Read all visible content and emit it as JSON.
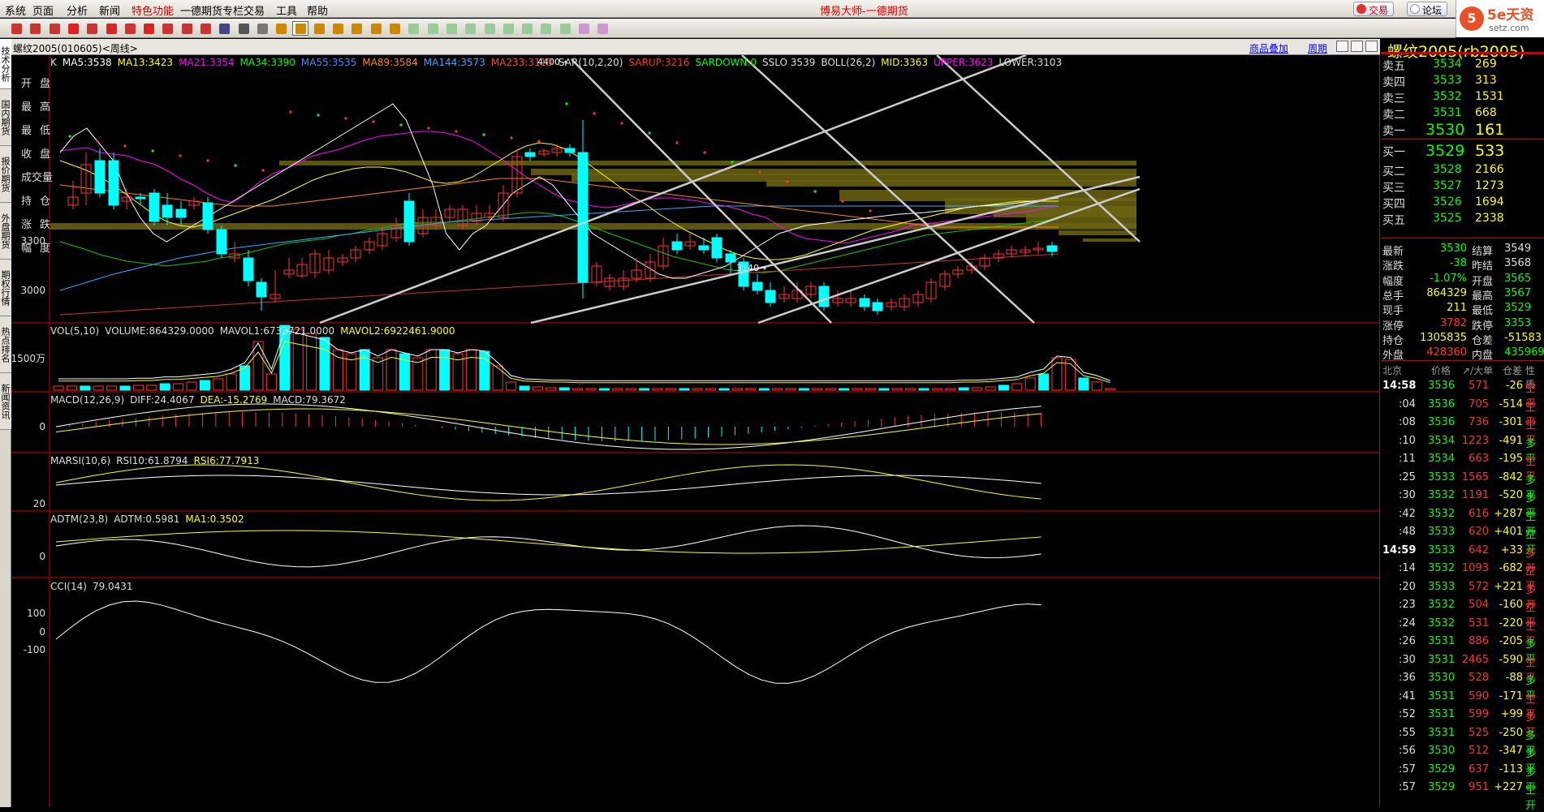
{
  "menu": [
    "系统",
    "页面",
    "分析",
    "新闻",
    "特色功能",
    "一德期货专栏",
    "交易",
    "工具",
    "帮助"
  ],
  "app_title": "博易大师-一德期货",
  "right_buttons": {
    "trade": "交易",
    "forum": "论坛"
  },
  "logo": {
    "mark": "5",
    "text": "5e天资",
    "sub": "setz.com"
  },
  "window_title": "螺纹2005(010605)<周线>",
  "links": {
    "overlay": "商品叠加",
    "cycle": "周期"
  },
  "left_tabs": [
    "技术分析",
    "国内期货",
    "报价期货",
    "外盘期货",
    "期权行情",
    "热点排名",
    "新闻资讯"
  ],
  "ohlc_labels": [
    "开盘",
    "最高",
    "最低",
    "收盘",
    "成交量",
    "持仓",
    "涨跌",
    "幅度"
  ],
  "main_indicator": [
    {
      "t": "K",
      "c": "#ddd"
    },
    {
      "t": "MA5:3538",
      "c": "#fff"
    },
    {
      "t": "MA13:3423",
      "c": "#ff0"
    },
    {
      "t": "MA21:3354",
      "c": "#f0f"
    },
    {
      "t": "MA34:3390",
      "c": "#0f0"
    },
    {
      "t": "MA55:3535",
      "c": "#48f"
    },
    {
      "t": "MA89:3584",
      "c": "#f80"
    },
    {
      "t": "MA144:3573",
      "c": "#3af"
    },
    {
      "t": "MA233:3113",
      "c": "#f44"
    },
    {
      "t": "SAR(10,2,20)",
      "c": "#ddd"
    },
    {
      "t": "SARUP:3216",
      "c": "#f33"
    },
    {
      "t": "SARDOWN:0",
      "c": "#0f0"
    },
    {
      "t": "SSLO 3539",
      "c": "#ddd"
    },
    {
      "t": "BOLL(26,2)",
      "c": "#ddd"
    },
    {
      "t": "MID:3363",
      "c": "#ff0"
    },
    {
      "t": "UPPER:3623",
      "c": "#f0f"
    },
    {
      "t": "LOWER:3103",
      "c": "#ddd"
    }
  ],
  "price_axis": [
    "3300",
    "3000"
  ],
  "price_notes": {
    "high": "4400",
    "low": "3140"
  },
  "vol_indicator": [
    {
      "t": "VOL(5,10)",
      "c": "#ddd"
    },
    {
      "t": "VOLUME:864329.0000",
      "c": "#ddd"
    },
    {
      "t": "MAVOL1:6733721.0000",
      "c": "#ddd"
    },
    {
      "t": "MAVOL2:6922461.9000",
      "c": "#ff0"
    }
  ],
  "vol_axis": "1500万",
  "macd_indicator": [
    {
      "t": "MACD(12,26,9)",
      "c": "#ddd"
    },
    {
      "t": "DIFF:24.4067",
      "c": "#ddd"
    },
    {
      "t": "DEA:-15.2769",
      "c": "#ff0"
    },
    {
      "t": "MACD:79.3672",
      "c": "#ddd"
    }
  ],
  "macd_axis": "0",
  "marsi_indicator": [
    {
      "t": "MARSI(10,6)",
      "c": "#ddd"
    },
    {
      "t": "RSI10:61.8794",
      "c": "#ddd"
    },
    {
      "t": "RSI6:77.7913",
      "c": "#ff0"
    }
  ],
  "marsi_axis": "20",
  "adtm_indicator": [
    {
      "t": "ADTM(23,8)",
      "c": "#ddd"
    },
    {
      "t": "ADTM:0.5981",
      "c": "#ddd"
    },
    {
      "t": "MA1:0.3502",
      "c": "#ff0"
    }
  ],
  "adtm_axis": "0",
  "cci_indicator": [
    {
      "t": "CCI(14)",
      "c": "#ddd"
    },
    {
      "t": "79.0431",
      "c": "#ddd"
    }
  ],
  "cci_axis": [
    "100",
    "0",
    "-100"
  ],
  "quote": {
    "symbol": "螺纹2005(rb2005)",
    "asks": [
      {
        "l": "卖五",
        "p": "3534",
        "v": "269"
      },
      {
        "l": "卖四",
        "p": "3533",
        "v": "313"
      },
      {
        "l": "卖三",
        "p": "3532",
        "v": "1531"
      },
      {
        "l": "卖二",
        "p": "3531",
        "v": "668"
      },
      {
        "l": "卖一",
        "p": "3530",
        "v": "161"
      }
    ],
    "bids": [
      {
        "l": "买一",
        "p": "3529",
        "v": "533"
      },
      {
        "l": "买二",
        "p": "3528",
        "v": "2166"
      },
      {
        "l": "买三",
        "p": "3527",
        "v": "1273"
      },
      {
        "l": "买四",
        "p": "3526",
        "v": "1694"
      },
      {
        "l": "买五",
        "p": "3525",
        "v": "2338"
      }
    ],
    "stats": [
      {
        "l1": "最新",
        "v1": "3530",
        "c1": "#0f0",
        "l2": "结算",
        "v2": "3549",
        "c2": "#ddd"
      },
      {
        "l1": "涨跌",
        "v1": "-38",
        "c1": "#0f0",
        "l2": "昨结",
        "v2": "3568",
        "c2": "#ddd"
      },
      {
        "l1": "幅度",
        "v1": "-1.07%",
        "c1": "#0f0",
        "l2": "开盘",
        "v2": "3565",
        "c2": "#0f0"
      },
      {
        "l1": "总手",
        "v1": "864329",
        "c1": "#ff0",
        "l2": "最高",
        "v2": "3567",
        "c2": "#0f0"
      },
      {
        "l1": "现手",
        "v1": "211",
        "c1": "#ff0",
        "l2": "最低",
        "v2": "3529",
        "c2": "#0f0"
      },
      {
        "l1": "涨停",
        "v1": "3782",
        "c1": "#f33",
        "l2": "跌停",
        "v2": "3353",
        "c2": "#0f0"
      },
      {
        "l1": "持仓",
        "v1": "1305835",
        "c1": "#ff0",
        "l2": "仓差",
        "v2": "-51583",
        "c2": "#ff0"
      },
      {
        "l1": "外盘",
        "v1": "428360",
        "c1": "#f33",
        "l2": "内盘",
        "v2": "435969",
        "c2": "#0f0"
      }
    ],
    "tick_header": [
      "北京",
      "价格",
      "↗/大单",
      "仓差",
      "性质"
    ],
    "ticks": [
      {
        "t": "14:58",
        "p": "3536",
        "v": "571",
        "d": "-26",
        "n": "空平",
        "tc": "#fff",
        "pc": "#0f0",
        "dc": "#ff0",
        "nc": "#f33"
      },
      {
        "t": ":04",
        "p": "3536",
        "v": "705",
        "d": "-514",
        "n": "空平",
        "tc": "#ddd",
        "pc": "#0f0",
        "dc": "#ff0",
        "nc": "#f33"
      },
      {
        "t": ":08",
        "p": "3536",
        "v": "736",
        "d": "-301",
        "n": "空平",
        "tc": "#ddd",
        "pc": "#0f0",
        "dc": "#ff0",
        "nc": "#f33"
      },
      {
        "t": ":10",
        "p": "3534",
        "v": "1223",
        "d": "-491",
        "n": "多平",
        "tc": "#ddd",
        "pc": "#0f0",
        "dc": "#ff0",
        "nc": "#0f0"
      },
      {
        "t": ":11",
        "p": "3534",
        "v": "663",
        "d": "-195",
        "n": "空平",
        "tc": "#ddd",
        "pc": "#0f0",
        "dc": "#ff0",
        "nc": "#f33"
      },
      {
        "t": ":25",
        "p": "3533",
        "v": "1565",
        "d": "-842",
        "n": "多平",
        "tc": "#ddd",
        "pc": "#0f0",
        "dc": "#ff0",
        "nc": "#0f0"
      },
      {
        "t": ":30",
        "p": "3532",
        "v": "1191",
        "d": "-520",
        "n": "多平",
        "tc": "#ddd",
        "pc": "#0f0",
        "dc": "#ff0",
        "nc": "#0f0"
      },
      {
        "t": ":42",
        "p": "3532",
        "v": "616",
        "d": "+287",
        "n": "空开",
        "tc": "#ddd",
        "pc": "#0f0",
        "dc": "#ff0",
        "nc": "#0f0"
      },
      {
        "t": ":48",
        "p": "3533",
        "v": "620",
        "d": "+401",
        "n": "空开",
        "tc": "#ddd",
        "pc": "#0f0",
        "dc": "#ff0",
        "nc": "#0f0"
      },
      {
        "t": "14:59",
        "p": "3533",
        "v": "642",
        "d": "+33",
        "n": "多开",
        "tc": "#fff",
        "pc": "#0f0",
        "dc": "#ff0",
        "nc": "#f33"
      },
      {
        "t": ":14",
        "p": "3532",
        "v": "1093",
        "d": "-682",
        "n": "空平",
        "tc": "#ddd",
        "pc": "#0f0",
        "dc": "#ff0",
        "nc": "#f33"
      },
      {
        "t": ":20",
        "p": "3533",
        "v": "572",
        "d": "+221",
        "n": "多开",
        "tc": "#ddd",
        "pc": "#0f0",
        "dc": "#ff0",
        "nc": "#f33"
      },
      {
        "t": ":23",
        "p": "3532",
        "v": "504",
        "d": "-160",
        "n": "空平",
        "tc": "#ddd",
        "pc": "#0f0",
        "dc": "#ff0",
        "nc": "#f33"
      },
      {
        "t": ":24",
        "p": "3532",
        "v": "531",
        "d": "-220",
        "n": "空平",
        "tc": "#ddd",
        "pc": "#0f0",
        "dc": "#ff0",
        "nc": "#f33"
      },
      {
        "t": ":26",
        "p": "3531",
        "v": "886",
        "d": "-205",
        "n": "多平",
        "tc": "#ddd",
        "pc": "#0f0",
        "dc": "#ff0",
        "nc": "#0f0"
      },
      {
        "t": ":30",
        "p": "3531",
        "v": "2465",
        "d": "-590",
        "n": "空平",
        "tc": "#ddd",
        "pc": "#0f0",
        "dc": "#ff0",
        "nc": "#f33"
      },
      {
        "t": ":36",
        "p": "3530",
        "v": "528",
        "d": "-88",
        "n": "多平",
        "tc": "#ddd",
        "pc": "#0f0",
        "dc": "#ff0",
        "nc": "#0f0"
      },
      {
        "t": ":41",
        "p": "3531",
        "v": "590",
        "d": "-171",
        "n": "空平",
        "tc": "#ddd",
        "pc": "#0f0",
        "dc": "#ff0",
        "nc": "#f33"
      },
      {
        "t": ":52",
        "p": "3531",
        "v": "599",
        "d": "+99",
        "n": "多开",
        "tc": "#ddd",
        "pc": "#0f0",
        "dc": "#ff0",
        "nc": "#f33"
      },
      {
        "t": ":55",
        "p": "3531",
        "v": "525",
        "d": "-250",
        "n": "多平",
        "tc": "#ddd",
        "pc": "#0f0",
        "dc": "#ff0",
        "nc": "#0f0"
      },
      {
        "t": ":56",
        "p": "3530",
        "v": "512",
        "d": "-347",
        "n": "多平",
        "tc": "#ddd",
        "pc": "#0f0",
        "dc": "#ff0",
        "nc": "#0f0"
      },
      {
        "t": ":57",
        "p": "3529",
        "v": "637",
        "d": "-113",
        "n": "多平",
        "tc": "#ddd",
        "pc": "#0f0",
        "dc": "#ff0",
        "nc": "#0f0"
      },
      {
        "t": ":57",
        "p": "3529",
        "v": "951",
        "d": "+227",
        "n": "空开",
        "tc": "#ddd",
        "pc": "#0f0",
        "dc": "#ff0",
        "nc": "#0f0"
      }
    ]
  },
  "colors": {
    "up": "#f33",
    "down": "#0ff",
    "accent": "#ff0",
    "bg": "#000"
  }
}
